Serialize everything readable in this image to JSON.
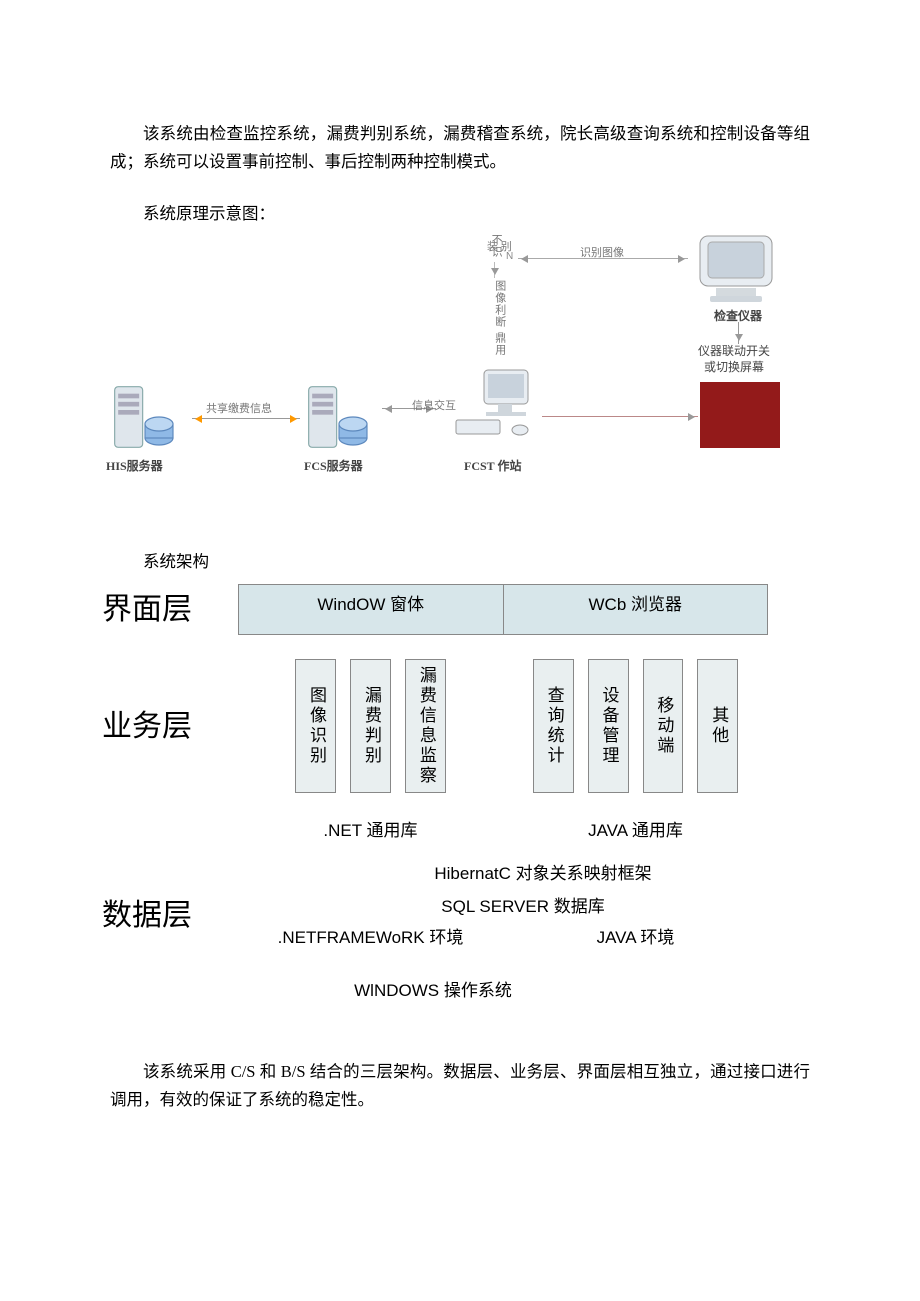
{
  "paragraph_top": "该系统由检查监控系统，漏费判别系统，漏费稽查系统，院长高级查询系统和控制设备等组成；系统可以设置事前控制、事后控制两种控制模式。",
  "caption_fig1": "系统原理示意图：",
  "fig1": {
    "node_his": "HIS服务器",
    "node_fcs": "FCS服务器",
    "node_work": "FCST 作站",
    "node_equip": "检查仪器",
    "node_switch": "仪器联动开关\n或切换屏幕",
    "edge_share": "共享缴费信息",
    "edge_info": "信息交互",
    "edge_img": "识别图像",
    "vlabel_top1": "不识",
    "vlabel_top2": "装 别",
    "vlabel_mid": "图像利断",
    "vlabel_bot": "鼎用"
  },
  "caption_arch": "系统架构",
  "arch": {
    "row_ui_title": "界面层",
    "ui_left": "WindOW 窗体",
    "ui_right": "WCb 浏览器",
    "row_biz_title": "业务层",
    "biz_left": [
      "图像识别",
      "漏费判别",
      "漏费信息监察"
    ],
    "biz_right": [
      "查询统计",
      "设备管理",
      "移动端",
      "其他"
    ],
    "lib_left": ".NET 通用库",
    "lib_right": "JAVA 通用库",
    "row_data_title": "数据层",
    "hibernate": "HibernatC 对象关系映射框架",
    "sql": "SQL SERVER 数据库",
    "env_left": ".NETFRAMEWoRK 环境",
    "env_right": "JAVA 环境",
    "os": "WlNDOWS 操作系统"
  },
  "paragraph_bottom": "该系统采用 C/S 和 B/S 结合的三层架构。数据层、业务层、界面层相互独立，通过接口进行调用，有效的保证了系统的稳定性。"
}
